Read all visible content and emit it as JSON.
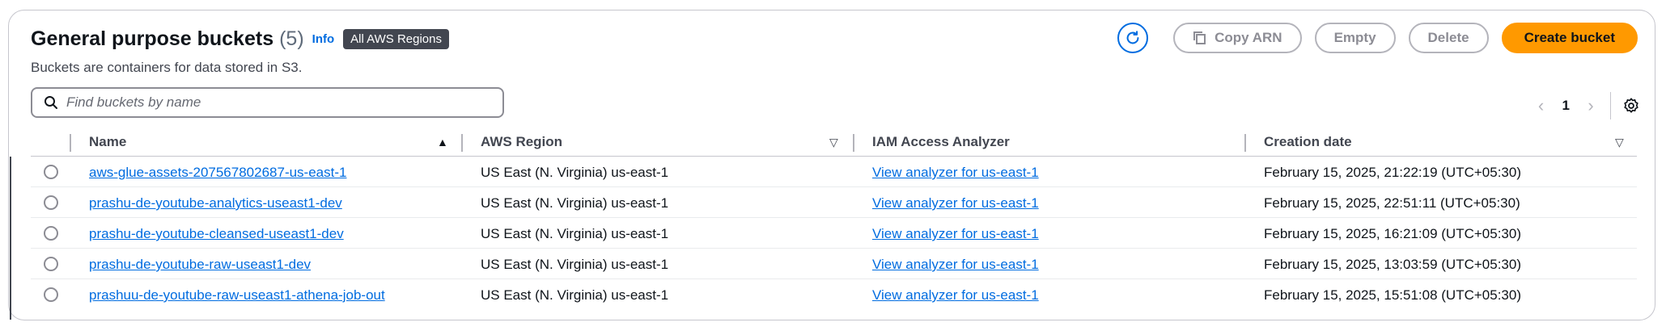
{
  "header": {
    "title": "General purpose buckets",
    "count": "(5)",
    "info_label": "Info",
    "region_badge": "All AWS Regions",
    "subtitle": "Buckets are containers for data stored in S3."
  },
  "actions": {
    "copy_arn": "Copy ARN",
    "empty": "Empty",
    "delete": "Delete",
    "create_bucket": "Create bucket"
  },
  "search": {
    "placeholder": "Find buckets by name",
    "value": ""
  },
  "pagination": {
    "page": "1",
    "prev": "‹",
    "next": "›"
  },
  "columns": {
    "name": "Name",
    "region": "AWS Region",
    "iam": "IAM Access Analyzer",
    "created": "Creation date"
  },
  "rows": [
    {
      "name": "aws-glue-assets-207567802687-us-east-1",
      "region": "US East (N. Virginia) us-east-1",
      "iam": "View analyzer for us-east-1",
      "created": "February 15, 2025, 21:22:19 (UTC+05:30)"
    },
    {
      "name": "prashu-de-youtube-analytics-useast1-dev",
      "region": "US East (N. Virginia) us-east-1",
      "iam": "View analyzer for us-east-1",
      "created": "February 15, 2025, 22:51:11 (UTC+05:30)"
    },
    {
      "name": "prashu-de-youtube-cleansed-useast1-dev",
      "region": "US East (N. Virginia) us-east-1",
      "iam": "View analyzer for us-east-1",
      "created": "February 15, 2025, 16:21:09 (UTC+05:30)"
    },
    {
      "name": "prashu-de-youtube-raw-useast1-dev",
      "region": "US East (N. Virginia) us-east-1",
      "iam": "View analyzer for us-east-1",
      "created": "February 15, 2025, 13:03:59 (UTC+05:30)"
    },
    {
      "name": "prashuu-de-youtube-raw-useast1-athena-job-out",
      "region": "US East (N. Virginia) us-east-1",
      "iam": "View analyzer for us-east-1",
      "created": "February 15, 2025, 15:51:08 (UTC+05:30)"
    }
  ],
  "colors": {
    "link": "#006ce0",
    "primary": "#ff9900",
    "badge": "#424650"
  }
}
